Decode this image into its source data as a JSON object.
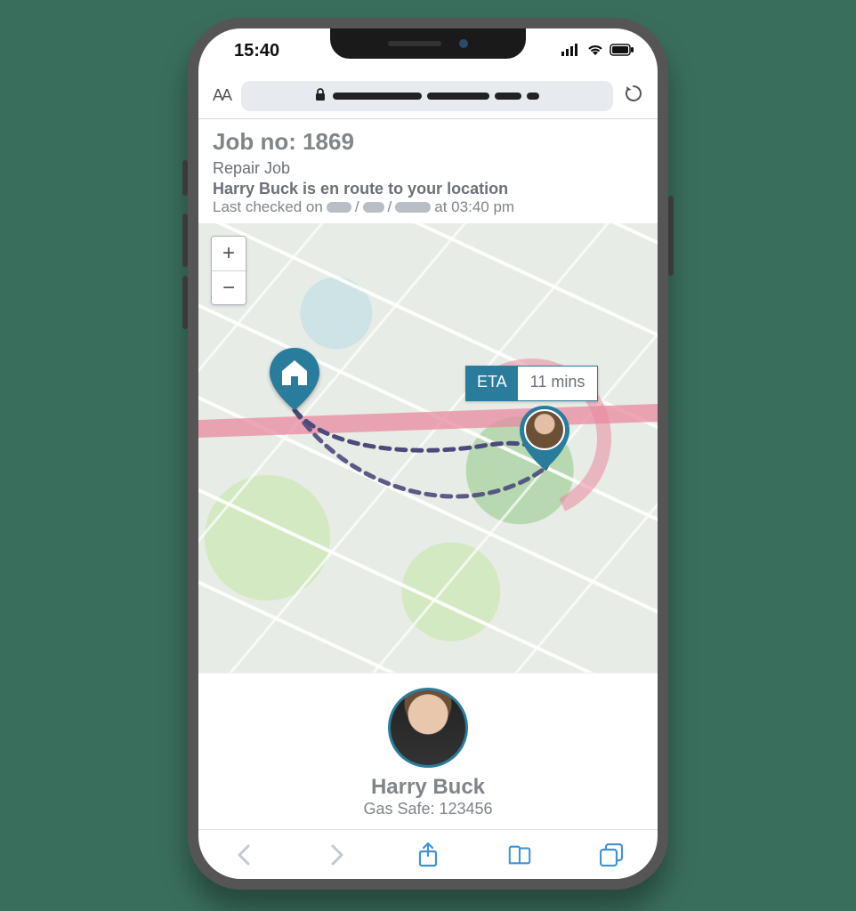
{
  "status_bar": {
    "time": "15:40"
  },
  "browser": {
    "text_size_glyph": "AA"
  },
  "job": {
    "number_label": "Job no: 1869",
    "type": "Repair Job",
    "status": "Harry Buck is en route to your location",
    "last_checked_prefix": "Last checked on",
    "last_checked_time": "at 03:40 pm"
  },
  "map": {
    "zoom_in": "+",
    "zoom_out": "−",
    "eta_label": "ETA",
    "eta_value": "11 mins"
  },
  "technician": {
    "name": "Harry Buck",
    "credential": "Gas Safe: 123456"
  },
  "colors": {
    "accent": "#2a7c9c"
  }
}
